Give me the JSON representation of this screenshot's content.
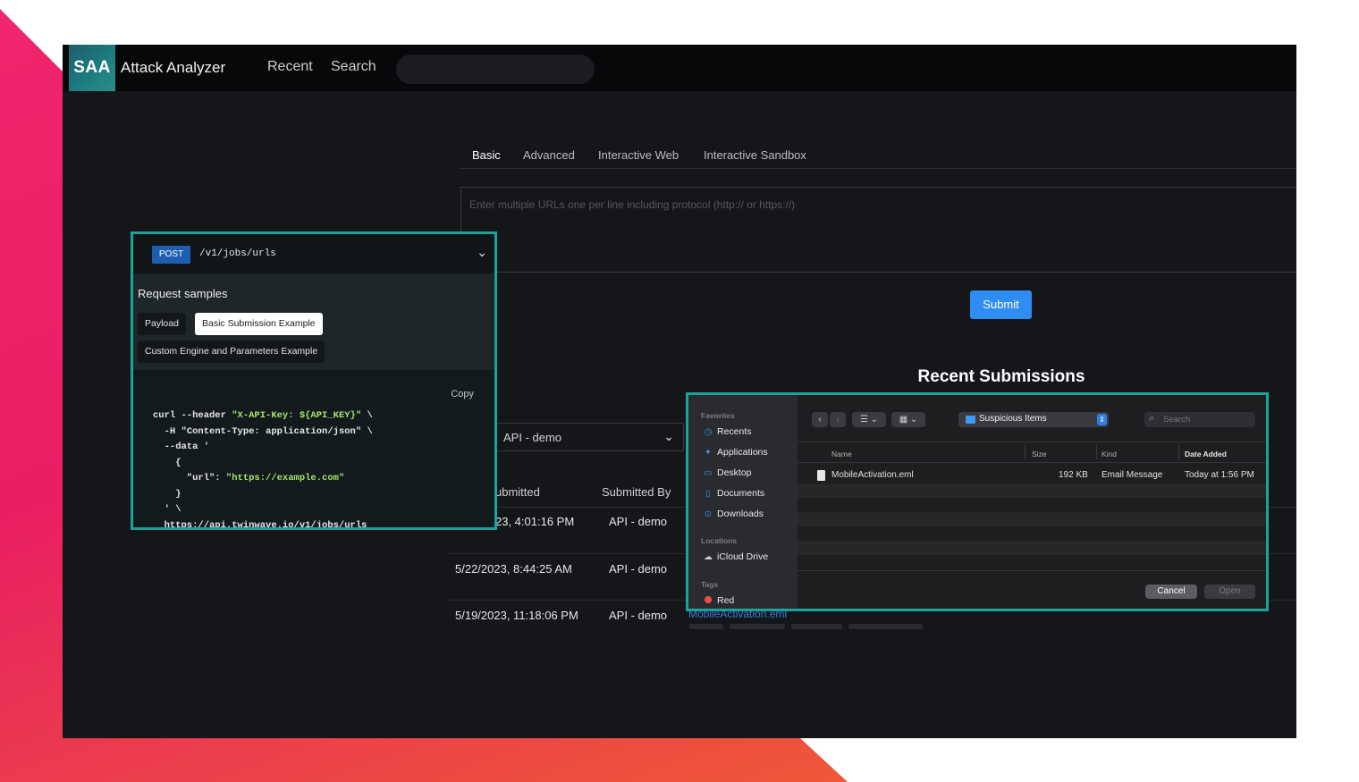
{
  "app": {
    "logo": "SAA",
    "title": "Attack Analyzer",
    "nav": {
      "recent": "Recent",
      "search": "Search"
    },
    "search_placeholder": ""
  },
  "submit_form": {
    "tabs": [
      {
        "label": "Basic",
        "active": true
      },
      {
        "label": "Advanced",
        "active": false
      },
      {
        "label": "Interactive Web",
        "active": false
      },
      {
        "label": "Interactive Sandbox",
        "active": false
      }
    ],
    "url_placeholder": "Enter multiple URLs one per line including protocol (http:// or https://)",
    "submit_label": "Submit",
    "engine_select_value": "API - demo"
  },
  "recent": {
    "title": "Recent Submissions",
    "columns": {
      "submitted": "ubmitted",
      "submitted_by": "Submitted By"
    },
    "rows": [
      {
        "submitted": "23, 4:01:16 PM",
        "by": "API - demo"
      },
      {
        "submitted": "5/22/2023, 8:44:25 AM",
        "by": "API - demo"
      },
      {
        "submitted": "5/19/2023, 11:18:06 PM",
        "by": "API - demo"
      }
    ],
    "partial_link": "MobileActivation.eml"
  },
  "api_docs": {
    "method": "POST",
    "path": "/v1/jobs/urls",
    "section_title": "Request samples",
    "chips": {
      "payload": "Payload",
      "basic": "Basic Submission Example",
      "custom": "Custom Engine and Parameters Example"
    },
    "copy_label": "Copy",
    "code": {
      "l1a": "curl --header ",
      "l1b": "\"X-API-Key: ${API_KEY}\"",
      "l1c": " \\",
      "l2a": "  -H ",
      "l2b": "\"Content-Type: application/json\"",
      "l2c": " \\",
      "l3": "  --data '",
      "l4": "    {",
      "l5a": "      \"url\": ",
      "l5b": "\"https://example.com\"",
      "l6": "    }",
      "l7": "  ' \\",
      "l8": "  https://api.twinwave.io/v1/jobs/urls"
    }
  },
  "file_dialog": {
    "sidebar": {
      "favorites_label": "Favorites",
      "favorites": [
        "Recents",
        "Applications",
        "Desktop",
        "Documents",
        "Downloads"
      ],
      "locations_label": "Locations",
      "locations": [
        "iCloud Drive"
      ],
      "tags_label": "Tags",
      "tags": [
        "Red"
      ]
    },
    "location": "Suspicious Items",
    "search_placeholder": "Search",
    "columns": {
      "name": "Name",
      "size": "Size",
      "kind": "Kind",
      "date_added": "Date Added"
    },
    "files": [
      {
        "name": "MobileActivation.eml",
        "size": "192 KB",
        "kind": "Email Message",
        "date_added": "Today at 1:56 PM"
      }
    ],
    "cancel_label": "Cancel",
    "open_label": "Open",
    "colors": {
      "accent": "#2f8cf3",
      "highlight_border": "#1aa39c",
      "tag_red": "#ee4c45"
    }
  }
}
